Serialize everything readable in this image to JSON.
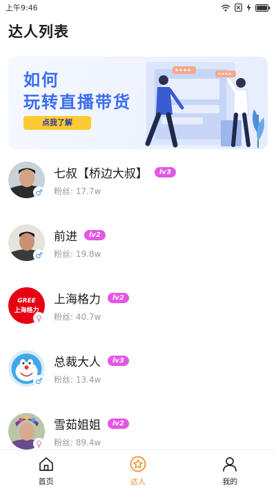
{
  "status_bar": {
    "time": "上午9:46"
  },
  "page": {
    "title": "达人列表"
  },
  "banner": {
    "line1": "如何",
    "line2": "玩转直播带货",
    "button_label": "点我了解"
  },
  "creators": [
    {
      "name": "七叔【桥边大叔】",
      "level": "lv3",
      "fans": "粉丝: 17.7w",
      "gender": "♂",
      "gender_type": "male"
    },
    {
      "name": "前进",
      "level": "lv2",
      "fans": "粉丝: 19.8w",
      "gender": "♂",
      "gender_type": "male"
    },
    {
      "name": "上海格力",
      "level": "lv2",
      "fans": "粉丝: 40.7w",
      "gender": "♀",
      "gender_type": "female",
      "avatar_logo": "GREE",
      "avatar_text": "上海格力"
    },
    {
      "name": "总裁大人",
      "level": "lv3",
      "fans": "粉丝: 13.4w",
      "gender": "♂",
      "gender_type": "male"
    },
    {
      "name": "雪茹姐姐",
      "level": "lv2",
      "fans": "粉丝: 89.4w",
      "gender": "♀",
      "gender_type": "female"
    }
  ],
  "tab_bar": {
    "tabs": [
      {
        "label": "首页",
        "icon": "home-icon"
      },
      {
        "label": "达人",
        "icon": "star-icon",
        "active": true
      },
      {
        "label": "我的",
        "icon": "profile-icon"
      }
    ]
  },
  "colors": {
    "accent": "#f08a26",
    "level_badge": "#e456e6",
    "banner_title": "#3b6cf0",
    "banner_button": "#ffc933"
  }
}
